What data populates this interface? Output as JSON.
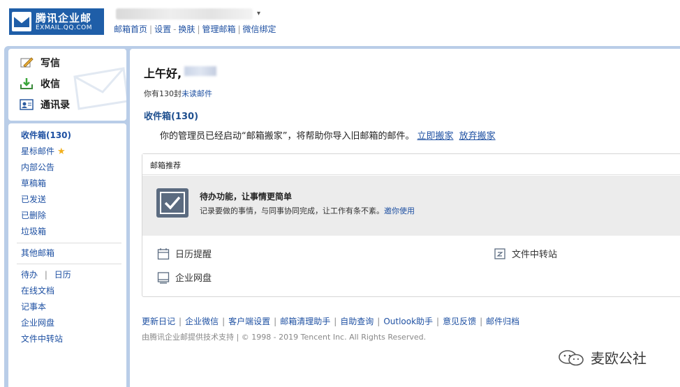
{
  "header": {
    "brand": "腾讯企业邮",
    "domain": "EXMAIL.QQ.COM",
    "user_caret": "▾",
    "links": [
      "邮箱首页",
      "设置",
      "换肤",
      "管理邮箱",
      "微信绑定"
    ]
  },
  "sidebar": {
    "actions": [
      {
        "label": "写信",
        "icon": "compose-icon"
      },
      {
        "label": "收信",
        "icon": "receive-icon"
      },
      {
        "label": "通讯录",
        "icon": "contacts-icon"
      }
    ],
    "folders": [
      {
        "label": "收件箱(130)",
        "bold": true
      },
      {
        "label": "星标邮件",
        "star": true
      },
      {
        "label": "内部公告"
      },
      {
        "label": "草稿箱"
      },
      {
        "label": "已发送"
      },
      {
        "label": "已删除"
      },
      {
        "label": "垃圾箱"
      }
    ],
    "other_mailbox": "其他邮箱",
    "tools_row": [
      "待办",
      "日历"
    ],
    "tools": [
      "在线文档",
      "记事本",
      "企业网盘",
      "文件中转站"
    ]
  },
  "main": {
    "greeting": "上午好,",
    "unread_prefix": "你有130封",
    "unread_link": "未读邮件",
    "inbox_title": "收件箱(130)",
    "notice_text": "你的管理员已经启动“邮箱搬家”，将帮助你导入旧邮箱的邮件。",
    "notice_links": [
      "立即搬家",
      "放弃搬家"
    ],
    "recommend": {
      "title": "邮箱推荐",
      "feature_title": "待办功能，让事情更简单",
      "feature_desc": "记录要做的事情，与同事协同完成，让工作有条不紊。",
      "feature_link": "邀你使用",
      "tools": [
        {
          "label": "日历提醒",
          "icon": "calendar-icon"
        },
        {
          "label": "文件中转站",
          "icon": "file-transfer-icon"
        },
        {
          "label": "企业网盘",
          "icon": "netdisk-icon"
        }
      ]
    },
    "footer_links": [
      "更新日记",
      "企业微信",
      "客户端设置",
      "邮箱清理助手",
      "自助查询",
      "Outlook助手",
      "意见反馈",
      "邮件归档"
    ],
    "copyright": "由腾讯企业邮提供技术支持 | © 1998 - 2019 Tencent Inc. All Rights Reserved."
  },
  "watermark": "麦欧公社",
  "colors": {
    "frame": "#b9cde8",
    "brand": "#1f5ea8",
    "link": "#1e50a2"
  }
}
